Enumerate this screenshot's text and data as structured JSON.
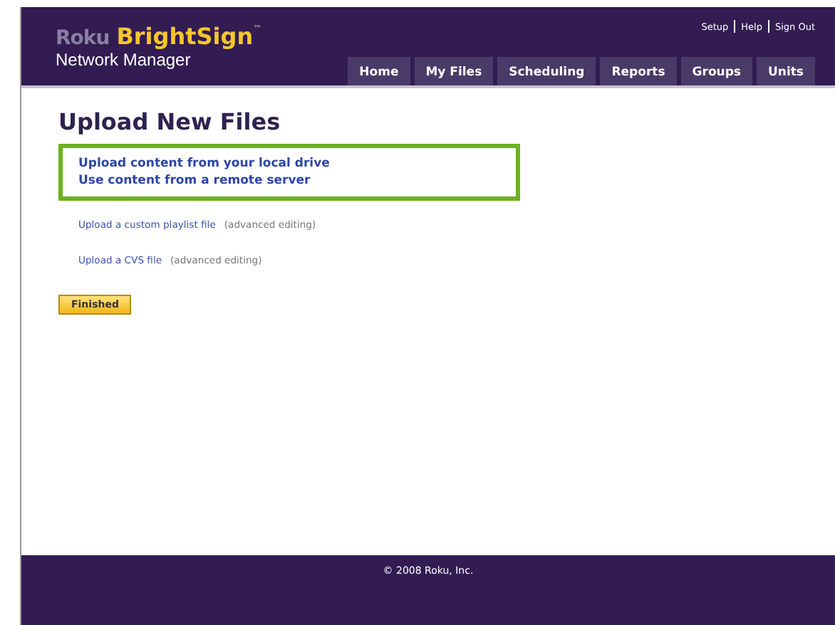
{
  "logo": {
    "brand": "Roku",
    "product": "BrightSign",
    "trademark": "™",
    "subtitle": "Network Manager"
  },
  "top_links": [
    "Setup",
    "Help",
    "Sign Out"
  ],
  "tabs": [
    {
      "label": "Home",
      "selected": false
    },
    {
      "label": "My Files",
      "selected": false
    },
    {
      "label": "Scheduling",
      "selected": false
    },
    {
      "label": "Reports",
      "selected": false
    },
    {
      "label": "Groups",
      "selected": false
    },
    {
      "label": "Units",
      "selected": false
    }
  ],
  "heading": "Upload New Files",
  "highlighted_links": [
    "Upload content from your local drive",
    "Use content from a remote server"
  ],
  "advanced_options": [
    {
      "link": "Upload a custom playlist file",
      "note": "(advanced editing)"
    },
    {
      "link": "Upload a CVS file",
      "note": "(advanced editing)"
    }
  ],
  "finished_button": "Finished",
  "footer": "© 2008 Roku, Inc."
}
